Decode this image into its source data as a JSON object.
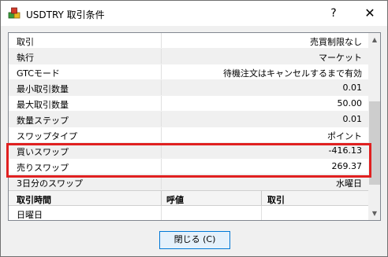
{
  "window": {
    "title": "USDTRY 取引条件",
    "help_label": "?",
    "close_label": "✕"
  },
  "icons": {
    "app": "cubes-app-icon",
    "scroll_up": "chevron-up-icon",
    "scroll_down": "chevron-down-icon"
  },
  "colors": {
    "highlight": "#e02020",
    "primary_button_border": "#0078d7"
  },
  "specs": [
    {
      "name": "取引",
      "value": "売買制限なし"
    },
    {
      "name": "執行",
      "value": "マーケット"
    },
    {
      "name": "GTCモード",
      "value": "待機注文はキャンセルするまで有効"
    },
    {
      "name": "最小取引数量",
      "value": "0.01"
    },
    {
      "name": "最大取引数量",
      "value": "50.00"
    },
    {
      "name": "数量ステップ",
      "value": "0.01"
    },
    {
      "name": "スワップタイプ",
      "value": "ポイント"
    },
    {
      "name": "買いスワップ",
      "value": "-416.13"
    },
    {
      "name": "売りスワップ",
      "value": "269.37"
    },
    {
      "name": "3日分のスワップ",
      "value": "水曜日"
    }
  ],
  "sessions": {
    "headers": [
      "取引時間",
      "呼値",
      "取引"
    ],
    "rows": [
      {
        "day": "日曜日",
        "quote": "",
        "trade": ""
      }
    ]
  },
  "buttons": {
    "close_dialog": "閉じる (C)"
  }
}
